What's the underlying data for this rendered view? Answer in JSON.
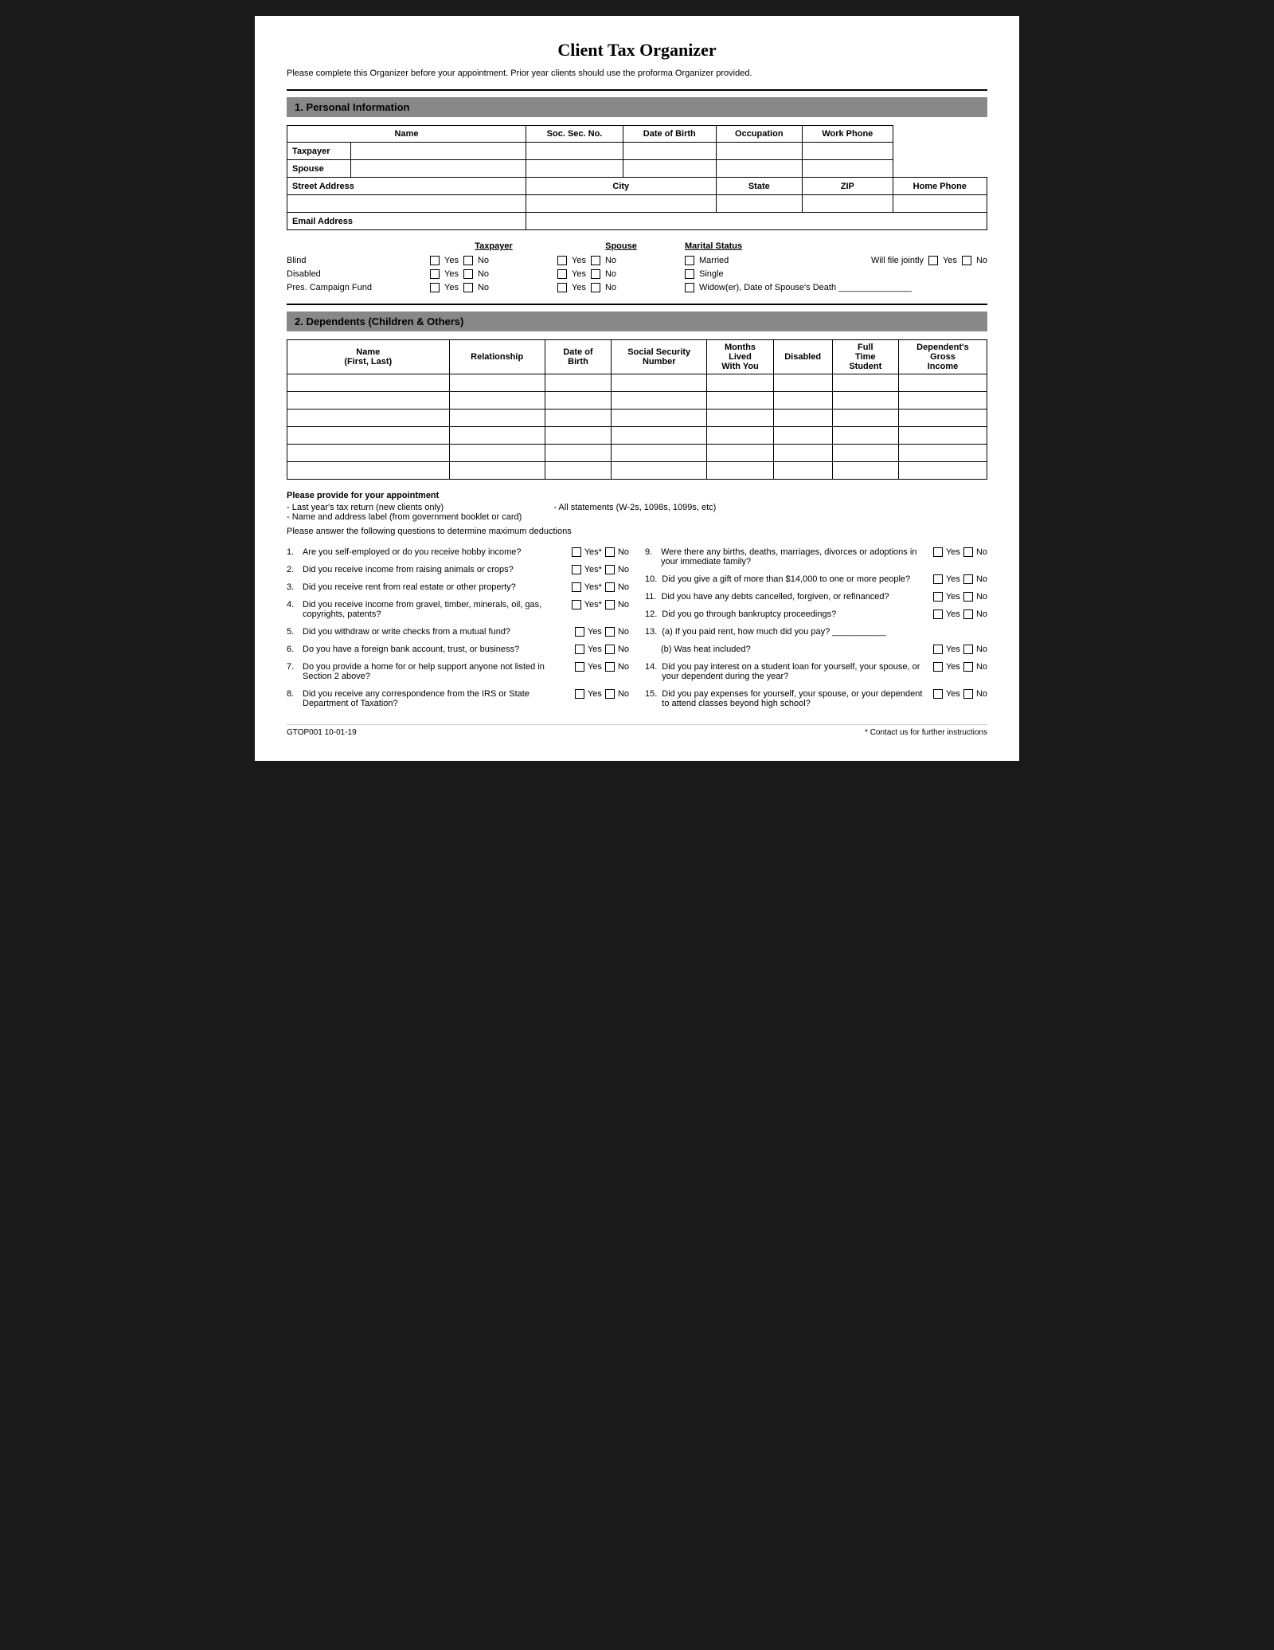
{
  "title": "Client Tax Organizer",
  "intro": "Please complete this Organizer before your appointment. Prior year clients should use the proforma Organizer provided.",
  "sections": {
    "personal": {
      "header": "1.  Personal Information",
      "table_headers": {
        "name": "Name",
        "soc_sec": "Soc. Sec. No.",
        "dob": "Date of Birth",
        "occupation": "Occupation",
        "work_phone": "Work Phone"
      },
      "rows": [
        "Taxpayer",
        "Spouse"
      ],
      "address_row": {
        "street": "Street Address",
        "city": "City",
        "state": "State",
        "zip": "ZIP",
        "home_phone": "Home Phone"
      },
      "email_row": "Email Address"
    },
    "checkboxes": {
      "taxpayer_label": "Taxpayer",
      "spouse_label": "Spouse",
      "marital_label": "Marital Status",
      "items": [
        {
          "label": "Blind"
        },
        {
          "label": "Disabled"
        },
        {
          "label": "Pres. Campaign Fund"
        }
      ],
      "options": [
        "Yes",
        "No"
      ],
      "marital_options": [
        "Married",
        "Single",
        "Widow(er), Date of Spouse's Death"
      ],
      "will_file_jointly": "Will file jointly",
      "wfj_options": [
        "Yes",
        "No"
      ]
    },
    "dependents": {
      "header": "2.  Dependents (Children & Others)",
      "columns": [
        "Name\n(First, Last)",
        "Relationship",
        "Date of\nBirth",
        "Social Security\nNumber",
        "Months\nLived\nWith You",
        "Disabled",
        "Full\nTime\nStudent",
        "Dependent's\nGross\nIncome"
      ],
      "num_rows": 6
    },
    "appointment": {
      "header": "Please provide for your appointment",
      "items_left": [
        "- Last year's tax return (new clients only)",
        "- Name and address label (from government booklet or card)"
      ],
      "items_right": [
        "- All statements (W-2s, 1098s, 1099s, etc)"
      ],
      "questions_header": "Please answer the following questions to determine maximum deductions"
    },
    "questions_left": [
      {
        "num": "1.",
        "text": "Are you self-employed or do you receive hobby income?",
        "answer": "Yes*",
        "answer2": "No"
      },
      {
        "num": "2.",
        "text": "Did you receive income from raising animals or crops?",
        "answer": "Yes*",
        "answer2": "No"
      },
      {
        "num": "3.",
        "text": "Did you receive rent from real estate or other property?",
        "answer": "Yes*",
        "answer2": "No"
      },
      {
        "num": "4.",
        "text": "Did you receive income from gravel, timber, minerals, oil, gas, copyrights, patents?",
        "answer": "Yes*",
        "answer2": "No"
      },
      {
        "num": "5.",
        "text": "Did you withdraw or write checks from a mutual fund?",
        "answer": "Yes",
        "answer2": "No"
      },
      {
        "num": "6.",
        "text": "Do you have a foreign bank account, trust, or business?",
        "answer": "Yes",
        "answer2": "No"
      },
      {
        "num": "7.",
        "text": "Do you provide a home for or help support anyone not listed in Section 2 above?",
        "answer": "Yes",
        "answer2": "No"
      },
      {
        "num": "8.",
        "text": "Did you receive any correspondence from the IRS or State Department of Taxation?",
        "answer": "Yes",
        "answer2": "No"
      }
    ],
    "questions_right": [
      {
        "num": "9.",
        "text": "Were there any births, deaths, marriages, divorces or adoptions in your immediate family?",
        "answer": "Yes",
        "answer2": "No"
      },
      {
        "num": "10.",
        "text": "Did you give a gift of more than $14,000 to one or more people?",
        "answer": "Yes",
        "answer2": "No"
      },
      {
        "num": "11.",
        "text": "Did you have any debts cancelled, forgiven, or refinanced?",
        "answer": "Yes",
        "answer2": "No"
      },
      {
        "num": "12.",
        "text": "Did you go through bankruptcy proceedings?",
        "answer": "Yes",
        "answer2": "No"
      },
      {
        "num": "13.",
        "text": "(a)  If you paid rent, how much did you pay?",
        "answer": "",
        "answer2": ""
      },
      {
        "num": "",
        "text": "(b)  Was heat included?",
        "answer": "Yes",
        "answer2": "No"
      },
      {
        "num": "14.",
        "text": "Did you pay interest on a student loan for yourself, your spouse, or your dependent during the year?",
        "answer": "Yes",
        "answer2": "No"
      },
      {
        "num": "15.",
        "text": "Did you pay expenses for yourself, your spouse, or your dependent to attend classes beyond high school?",
        "answer": "Yes",
        "answer2": "No"
      }
    ],
    "footer": {
      "code": "GTOP001 10-01-19",
      "note": "* Contact us for further instructions"
    }
  }
}
